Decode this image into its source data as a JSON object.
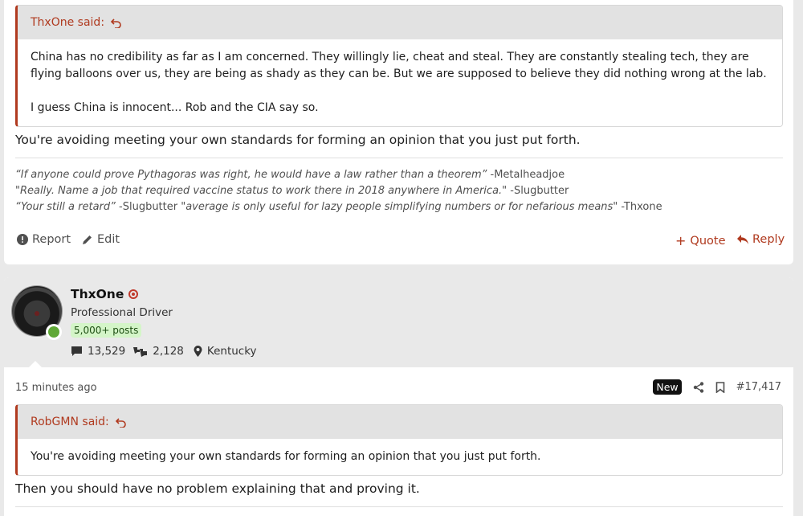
{
  "post1": {
    "quote": {
      "author": "ThxOne said:",
      "lines": [
        "China has no credibility as far as I am concerned. They willingly lie, cheat and steal. They are constantly stealing tech, they are flying balloons over us, they are being as shady as they can be. But we are supposed to believe they did nothing wrong at the lab.",
        "I guess China is innocent... Rob and the CIA say so."
      ]
    },
    "reply": "You're avoiding meeting your own standards for forming an opinion that you just put forth.",
    "signature": [
      {
        "quote": "“If anyone could prove Pythagoras was right, he would have a law rather than a theorem”",
        "attrib": " -Metalheadjoe"
      },
      {
        "quote": "\"Really. Name a job that required vaccine status to work there in 2018 anywhere in America.\"",
        "attrib": " -Slugbutter"
      },
      {
        "quote": "“Your still a retard”",
        "attrib": " -Slugbutter ",
        "quote2": "\"average is only useful for lazy people simplifying numbers or for nefarious means\"",
        "attrib2": " -Thxone"
      }
    ],
    "actions": {
      "report": "Report",
      "edit": "Edit",
      "quote": "Quote",
      "reply": "Reply"
    }
  },
  "post2": {
    "user": {
      "name": "ThxOne",
      "title": "Professional Driver",
      "posts_badge": "5,000+ posts",
      "messages": "13,529",
      "reactions": "2,128",
      "location": "Kentucky"
    },
    "time": "15 minutes ago",
    "new_label": "New",
    "post_number": "#17,417",
    "quote": {
      "author": "RobGMN said:",
      "lines": [
        "You're avoiding meeting your own standards for forming an opinion that you just put forth."
      ]
    },
    "reply": "Then you should have no problem explaining that and proving it."
  },
  "colors": {
    "accent": "#b03a1f",
    "online": "#5fa836",
    "badge_bg": "#d4f5c8"
  }
}
